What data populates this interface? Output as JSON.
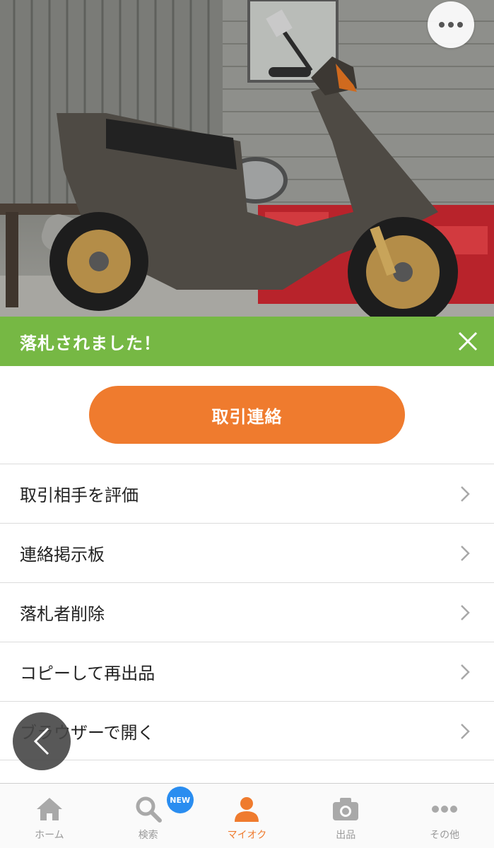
{
  "photo": {
    "alt": "scooter"
  },
  "more_button": {
    "icon": "more-horizontal-icon"
  },
  "banner": {
    "text": "落札されました！",
    "color": "#76b844"
  },
  "action": {
    "label": "取引連絡",
    "color": "#ef7b2e"
  },
  "menu": {
    "items": [
      {
        "label": "取引相手を評価"
      },
      {
        "label": "連絡掲示板"
      },
      {
        "label": "落札者削除"
      },
      {
        "label": "コピーして再出品"
      },
      {
        "label": "ブラウザーで開く"
      }
    ]
  },
  "tabbar": {
    "tabs": [
      {
        "label": "ホーム",
        "icon": "home-icon"
      },
      {
        "label": "検索",
        "icon": "search-icon",
        "badge": "NEW"
      },
      {
        "label": "マイオク",
        "icon": "user-icon",
        "active": true
      },
      {
        "label": "出品",
        "icon": "camera-icon"
      },
      {
        "label": "その他",
        "icon": "more-horizontal-icon"
      }
    ]
  }
}
